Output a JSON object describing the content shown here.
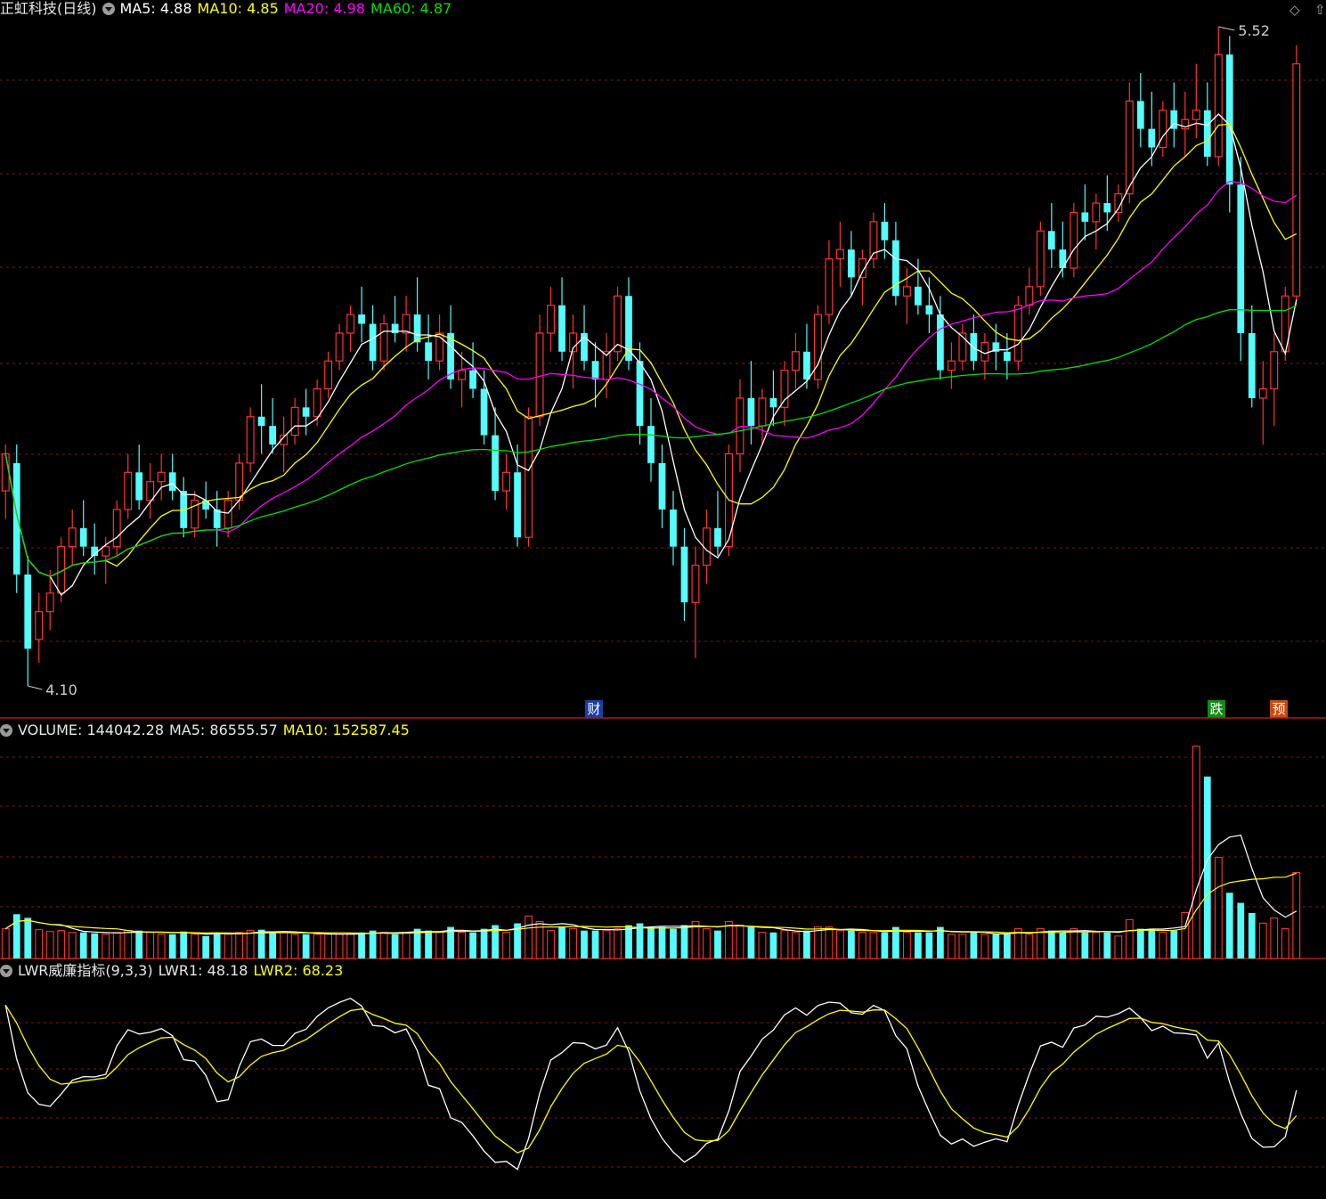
{
  "header": {
    "stock_name": "正虹科技(日线)",
    "ma5": "MA5: 4.88",
    "ma10": "MA10: 4.85",
    "ma20": "MA20: 4.98",
    "ma60": "MA60: 4.87"
  },
  "volume_header": {
    "volume": "VOLUME: 144042.28",
    "ma5": "MA5: 86555.57",
    "ma10": "MA10: 152587.45"
  },
  "lwr_header": {
    "name": "LWR威廉指标(9,3,3)",
    "lwr1": "LWR1: 48.18",
    "lwr2": "LWR2: 68.23"
  },
  "markers": {
    "high_label": "5.52",
    "low_label": "4.10",
    "tag_cai": "财",
    "tag_die": "跌",
    "tag_yu": "预"
  },
  "corner_icons": [
    "diamond-icon",
    "up-arrow-icon",
    "up-arrow-icon"
  ],
  "colors": {
    "up": "#ff3232",
    "down": "#54fcfc",
    "ma5": "#ffffff",
    "ma10": "#ffff00",
    "ma20": "#ff00ff",
    "ma60": "#00e000",
    "lwr1": "#ffffff",
    "lwr2": "#ffff00",
    "grid": "#7a1a1a",
    "separator": "#b01818"
  },
  "chart_data": [
    {
      "type": "candlestick",
      "panel": "price",
      "ylim": [
        4.1,
        5.52
      ],
      "high": 5.52,
      "low": 4.1,
      "series": [
        {
          "name": "MA5",
          "last": 4.88
        },
        {
          "name": "MA10",
          "last": 4.85
        },
        {
          "name": "MA20",
          "last": 4.98
        },
        {
          "name": "MA60",
          "last": 4.87
        }
      ],
      "ohlc": [
        [
          4.52,
          4.62,
          4.46,
          4.6
        ],
        [
          4.58,
          4.62,
          4.3,
          4.34
        ],
        [
          4.34,
          4.38,
          4.1,
          4.18
        ],
        [
          4.2,
          4.3,
          4.15,
          4.26
        ],
        [
          4.26,
          4.35,
          4.22,
          4.3
        ],
        [
          4.3,
          4.42,
          4.28,
          4.4
        ],
        [
          4.4,
          4.48,
          4.36,
          4.44
        ],
        [
          4.44,
          4.5,
          4.38,
          4.4
        ],
        [
          4.4,
          4.45,
          4.34,
          4.38
        ],
        [
          4.38,
          4.42,
          4.32,
          4.4
        ],
        [
          4.4,
          4.5,
          4.38,
          4.48
        ],
        [
          4.48,
          4.6,
          4.46,
          4.56
        ],
        [
          4.56,
          4.62,
          4.48,
          4.5
        ],
        [
          4.5,
          4.58,
          4.46,
          4.54
        ],
        [
          4.54,
          4.6,
          4.5,
          4.56
        ],
        [
          4.56,
          4.6,
          4.5,
          4.52
        ],
        [
          4.52,
          4.55,
          4.42,
          4.44
        ],
        [
          4.44,
          4.52,
          4.42,
          4.5
        ],
        [
          4.5,
          4.54,
          4.46,
          4.48
        ],
        [
          4.48,
          4.52,
          4.4,
          4.44
        ],
        [
          4.44,
          4.52,
          4.42,
          4.5
        ],
        [
          4.5,
          4.6,
          4.48,
          4.58
        ],
        [
          4.58,
          4.7,
          4.56,
          4.68
        ],
        [
          4.68,
          4.75,
          4.6,
          4.66
        ],
        [
          4.66,
          4.72,
          4.6,
          4.62
        ],
        [
          4.62,
          4.68,
          4.56,
          4.64
        ],
        [
          4.64,
          4.72,
          4.62,
          4.7
        ],
        [
          4.7,
          4.74,
          4.64,
          4.68
        ],
        [
          4.68,
          4.76,
          4.66,
          4.74
        ],
        [
          4.74,
          4.82,
          4.72,
          4.8
        ],
        [
          4.8,
          4.88,
          4.78,
          4.86
        ],
        [
          4.86,
          4.92,
          4.82,
          4.9
        ],
        [
          4.9,
          4.96,
          4.84,
          4.88
        ],
        [
          4.88,
          4.92,
          4.78,
          4.8
        ],
        [
          4.8,
          4.9,
          4.78,
          4.88
        ],
        [
          4.88,
          4.94,
          4.84,
          4.86
        ],
        [
          4.86,
          4.94,
          4.82,
          4.9
        ],
        [
          4.9,
          4.98,
          4.82,
          4.84
        ],
        [
          4.84,
          4.9,
          4.76,
          4.8
        ],
        [
          4.8,
          4.9,
          4.78,
          4.86
        ],
        [
          4.86,
          4.92,
          4.74,
          4.76
        ],
        [
          4.76,
          4.82,
          4.7,
          4.78
        ],
        [
          4.78,
          4.84,
          4.72,
          4.74
        ],
        [
          4.74,
          4.78,
          4.62,
          4.64
        ],
        [
          4.64,
          4.7,
          4.5,
          4.52
        ],
        [
          4.52,
          4.6,
          4.48,
          4.56
        ],
        [
          4.56,
          4.62,
          4.4,
          4.42
        ],
        [
          4.42,
          4.7,
          4.4,
          4.68
        ],
        [
          4.68,
          4.9,
          4.66,
          4.86
        ],
        [
          4.86,
          4.96,
          4.82,
          4.92
        ],
        [
          4.92,
          4.98,
          4.8,
          4.82
        ],
        [
          4.82,
          4.9,
          4.74,
          4.86
        ],
        [
          4.86,
          4.92,
          4.78,
          4.8
        ],
        [
          4.8,
          4.84,
          4.7,
          4.76
        ],
        [
          4.76,
          4.86,
          4.72,
          4.82
        ],
        [
          4.82,
          4.96,
          4.8,
          4.94
        ],
        [
          4.94,
          4.98,
          4.78,
          4.8
        ],
        [
          4.8,
          4.84,
          4.62,
          4.66
        ],
        [
          4.66,
          4.72,
          4.54,
          4.58
        ],
        [
          4.58,
          4.62,
          4.44,
          4.48
        ],
        [
          4.48,
          4.52,
          4.36,
          4.4
        ],
        [
          4.4,
          4.44,
          4.24,
          4.28
        ],
        [
          4.28,
          4.4,
          4.16,
          4.36
        ],
        [
          4.36,
          4.48,
          4.32,
          4.44
        ],
        [
          4.44,
          4.52,
          4.38,
          4.4
        ],
        [
          4.4,
          4.62,
          4.38,
          4.6
        ],
        [
          4.6,
          4.76,
          4.56,
          4.72
        ],
        [
          4.72,
          4.8,
          4.62,
          4.66
        ],
        [
          4.66,
          4.74,
          4.62,
          4.72
        ],
        [
          4.72,
          4.78,
          4.66,
          4.7
        ],
        [
          4.7,
          4.8,
          4.66,
          4.78
        ],
        [
          4.78,
          4.86,
          4.74,
          4.82
        ],
        [
          4.82,
          4.88,
          4.74,
          4.76
        ],
        [
          4.76,
          4.92,
          4.74,
          4.9
        ],
        [
          4.9,
          5.06,
          4.88,
          5.02
        ],
        [
          5.02,
          5.1,
          4.96,
          5.04
        ],
        [
          5.04,
          5.08,
          4.94,
          4.98
        ],
        [
          4.98,
          5.04,
          4.92,
          5.02
        ],
        [
          5.02,
          5.12,
          5.0,
          5.1
        ],
        [
          5.1,
          5.14,
          5.02,
          5.06
        ],
        [
          5.06,
          5.1,
          4.92,
          4.94
        ],
        [
          4.94,
          5.0,
          4.88,
          4.96
        ],
        [
          4.96,
          5.02,
          4.9,
          4.92
        ],
        [
          4.92,
          4.98,
          4.86,
          4.9
        ],
        [
          4.9,
          4.94,
          4.76,
          4.78
        ],
        [
          4.78,
          4.84,
          4.74,
          4.8
        ],
        [
          4.8,
          4.88,
          4.78,
          4.86
        ],
        [
          4.86,
          4.9,
          4.78,
          4.8
        ],
        [
          4.8,
          4.86,
          4.76,
          4.84
        ],
        [
          4.84,
          4.88,
          4.78,
          4.82
        ],
        [
          4.82,
          4.86,
          4.76,
          4.8
        ],
        [
          4.8,
          4.94,
          4.78,
          4.92
        ],
        [
          4.92,
          5.0,
          4.9,
          4.96
        ],
        [
          4.96,
          5.1,
          4.94,
          5.08
        ],
        [
          5.08,
          5.14,
          5.0,
          5.04
        ],
        [
          5.04,
          5.1,
          4.98,
          5.0
        ],
        [
          5.0,
          5.14,
          4.98,
          5.12
        ],
        [
          5.12,
          5.18,
          5.06,
          5.1
        ],
        [
          5.1,
          5.16,
          5.04,
          5.14
        ],
        [
          5.14,
          5.2,
          5.08,
          5.12
        ],
        [
          5.12,
          5.18,
          5.1,
          5.16
        ],
        [
          5.16,
          5.4,
          5.14,
          5.36
        ],
        [
          5.36,
          5.42,
          5.26,
          5.3
        ],
        [
          5.3,
          5.38,
          5.22,
          5.26
        ],
        [
          5.26,
          5.36,
          5.24,
          5.34
        ],
        [
          5.34,
          5.4,
          5.26,
          5.3
        ],
        [
          5.3,
          5.38,
          5.24,
          5.32
        ],
        [
          5.32,
          5.44,
          5.28,
          5.34
        ],
        [
          5.34,
          5.4,
          5.22,
          5.24
        ],
        [
          5.24,
          5.52,
          5.22,
          5.46
        ],
        [
          5.46,
          5.5,
          5.12,
          5.18
        ],
        [
          5.18,
          5.24,
          4.8,
          4.86
        ],
        [
          4.86,
          4.92,
          4.7,
          4.72
        ],
        [
          4.72,
          4.8,
          4.62,
          4.74
        ],
        [
          4.74,
          4.86,
          4.66,
          4.82
        ],
        [
          4.82,
          4.96,
          4.8,
          4.94
        ],
        [
          4.94,
          5.48,
          4.92,
          5.44
        ]
      ]
    },
    {
      "type": "bar",
      "panel": "volume",
      "series": [
        {
          "name": "VOLUME",
          "last": 144042.28
        },
        {
          "name": "MA5",
          "last": 86555.57
        },
        {
          "name": "MA10",
          "last": 152587.45
        }
      ]
    },
    {
      "type": "line",
      "panel": "lwr",
      "ylim": [
        0,
        100
      ],
      "series": [
        {
          "name": "LWR1",
          "last": 48.18
        },
        {
          "name": "LWR2",
          "last": 68.23
        }
      ]
    }
  ]
}
